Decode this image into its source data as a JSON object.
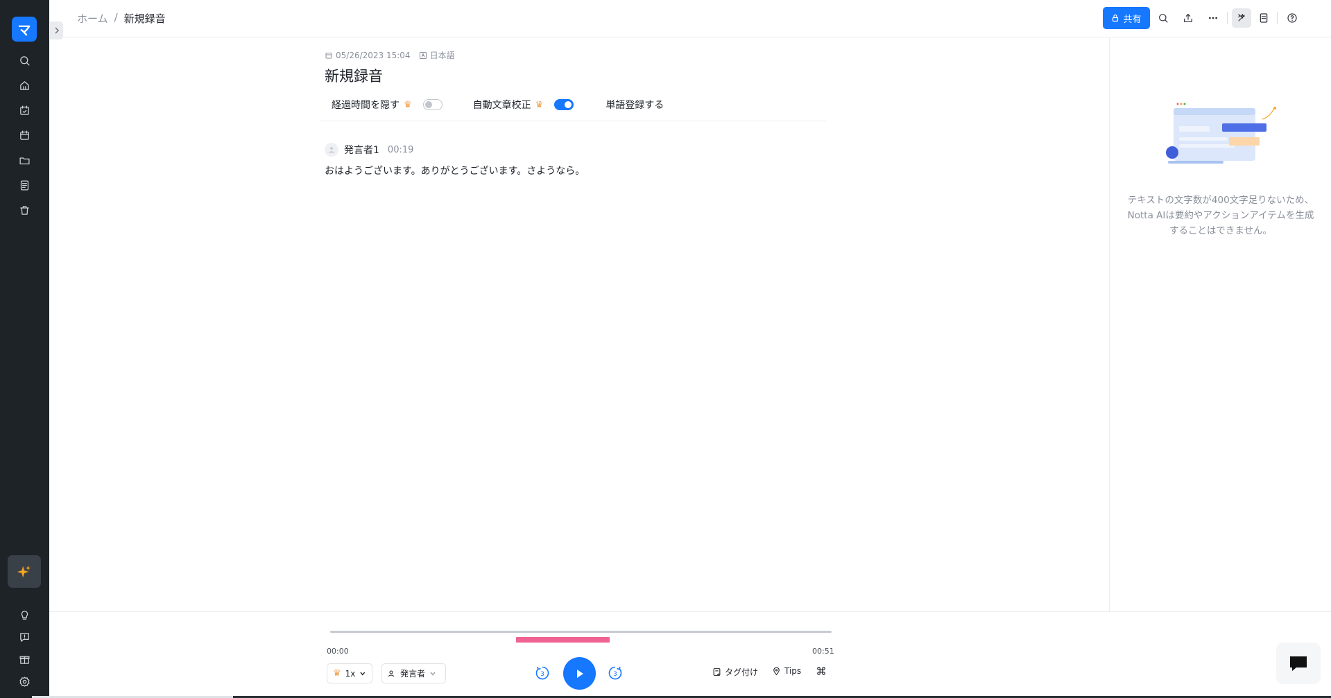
{
  "app": {
    "logo_glyph": "マ",
    "accent": "#1677ff"
  },
  "sidebar": {
    "items": [
      {
        "name": "search",
        "icon": "search-icon"
      },
      {
        "name": "home",
        "icon": "home-icon"
      },
      {
        "name": "schedule",
        "icon": "calendar-edit-icon"
      },
      {
        "name": "calendar",
        "icon": "calendar-icon"
      },
      {
        "name": "folder",
        "icon": "folder-icon"
      },
      {
        "name": "notes",
        "icon": "document-icon"
      },
      {
        "name": "trash",
        "icon": "trash-icon"
      }
    ],
    "bottom_items": [
      "lightbulb-icon",
      "feedback-icon",
      "gift-icon",
      "settings-icon"
    ]
  },
  "breadcrumb": {
    "home": "ホーム",
    "separator": "/",
    "current": "新規録音"
  },
  "toolbar": {
    "share_label": "共有"
  },
  "record": {
    "datetime": "05/26/2023 15:04",
    "language": "日本語",
    "title": "新規録音"
  },
  "options": {
    "hide_time_label": "経過時間を隠す",
    "hide_time_on": false,
    "auto_correct_label": "自動文章校正",
    "auto_correct_on": true,
    "word_register_label": "単語登録する"
  },
  "transcript": [
    {
      "speaker": "発言者1",
      "time": "00:19",
      "text": "おはようございます。ありがとうございます。さようなら。"
    }
  ],
  "right_panel": {
    "notice": "テキストの文字数が400文字足りないため、Notta AIは要約やアクションアイテムを生成することはできません。"
  },
  "player": {
    "time_start": "00:00",
    "time_end": "00:51",
    "speed": "1x",
    "speaker_filter": "発言者",
    "skip_back": "3",
    "skip_forward": "3",
    "tag_label": "タグ付け",
    "tips_label": "Tips"
  }
}
